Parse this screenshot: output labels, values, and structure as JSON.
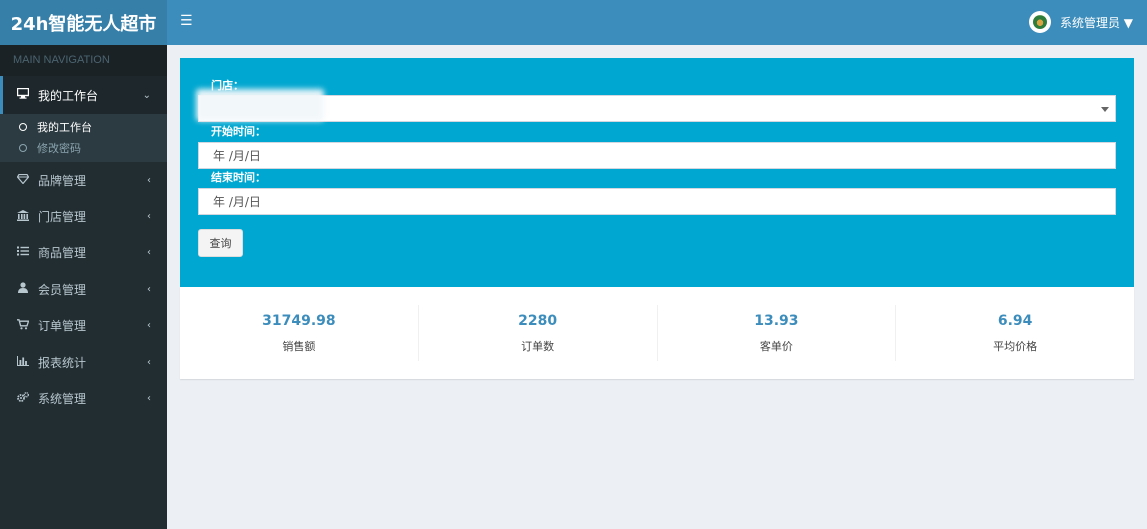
{
  "app": {
    "logo": "24h智能无人超市"
  },
  "header": {
    "menu_icon": "hamburger-icon",
    "user_name": "系统管理员 ▼"
  },
  "sidebar": {
    "nav_header": "MAIN NAVIGATION",
    "workspace": {
      "label": "我的工作台",
      "icon": "desktop-icon"
    },
    "submenu": [
      {
        "label": "我的工作台"
      },
      {
        "label": "修改密码"
      }
    ],
    "items": [
      {
        "label": "品牌管理",
        "icon": "diamond-icon"
      },
      {
        "label": "门店管理",
        "icon": "bank-icon"
      },
      {
        "label": "商品管理",
        "icon": "list-icon"
      },
      {
        "label": "会员管理",
        "icon": "user-icon"
      },
      {
        "label": "订单管理",
        "icon": "cart-icon"
      },
      {
        "label": "报表统计",
        "icon": "bar-chart-icon"
      },
      {
        "label": "系统管理",
        "icon": "gears-icon"
      }
    ]
  },
  "filter": {
    "store_label": "门店：",
    "store_value": "",
    "start_label": "开始时间：",
    "start_value": "年 /月/日",
    "end_label": "结束时间：",
    "end_value": "年 /月/日",
    "query_button": "查询"
  },
  "stats": [
    {
      "value": "31749.98",
      "label": "销售额"
    },
    {
      "value": "2280",
      "label": "订单数"
    },
    {
      "value": "13.93",
      "label": "客单价"
    },
    {
      "value": "6.94",
      "label": "平均价格"
    }
  ],
  "colors": {
    "header": "#3c8dbc",
    "logo": "#367fa9",
    "sidebar": "#222d32",
    "filter_box": "#00a7d0",
    "stat_value": "#3c8dbc"
  }
}
